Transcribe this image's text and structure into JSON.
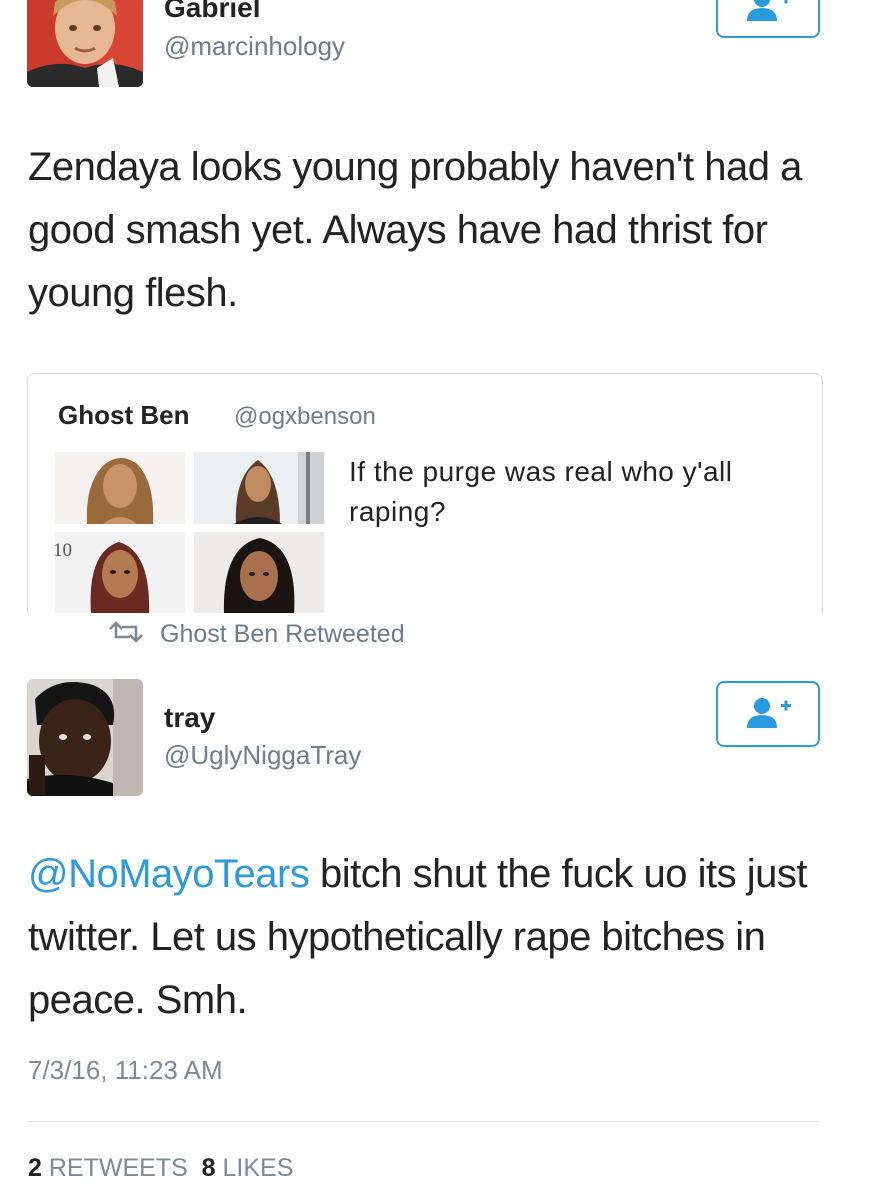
{
  "tweet1": {
    "author_name": "Gabriel",
    "author_handle": "@marcinhology",
    "text": "Zendaya looks young probably haven't had a good smash yet. Always have had thrist for young flesh.",
    "follow_icon": "add-user-icon"
  },
  "quoted_tweet": {
    "author_name": "Ghost Ben",
    "author_handle": "@ogxbenson",
    "text": "If the purge was real who y'all raping?",
    "image_text": "10"
  },
  "retweet_context": {
    "icon": "retweet-icon",
    "label": "Ghost Ben Retweeted"
  },
  "tweet2": {
    "author_name": "tray",
    "author_handle": "@UglyNiggaTray",
    "mention": "@NoMayoTears",
    "text": " bitch shut the fuck uo its just twitter. Let us hypothetically rape bitches in peace. Smh.",
    "timestamp": "7/3/16, 11:23 AM",
    "retweets_count": "2",
    "retweets_label": "RETWEETS",
    "likes_count": "8",
    "likes_label": "LIKES",
    "follow_icon": "add-user-icon"
  },
  "colors": {
    "accent": "#2b9bdf",
    "secondary_text": "#6f7d8a",
    "border": "#d3dbe2"
  }
}
